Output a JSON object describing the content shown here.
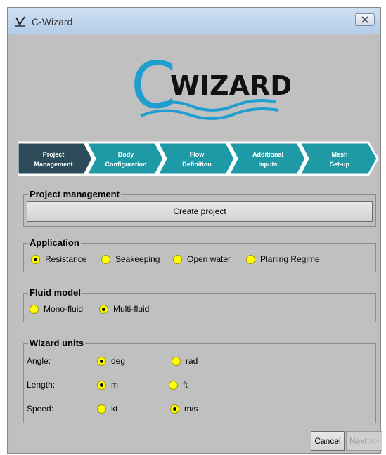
{
  "window": {
    "title": "C-Wizard",
    "close_icon": "close-icon"
  },
  "logo": {
    "text": "WIZARD",
    "letter": "C"
  },
  "steps": [
    {
      "line1": "Project",
      "line2": "Management",
      "active": true
    },
    {
      "line1": "Body",
      "line2": "Configuration",
      "active": false
    },
    {
      "line1": "Flow",
      "line2": "Definition",
      "active": false
    },
    {
      "line1": "Additional",
      "line2": "Inputs",
      "active": false
    },
    {
      "line1": "Mesh",
      "line2": "Set-up",
      "active": false
    }
  ],
  "project_management": {
    "title": "Project management",
    "create_label": "Create project"
  },
  "application": {
    "title": "Application",
    "options": [
      "Resistance",
      "Seakeeping",
      "Open water",
      "Planing Regime"
    ],
    "selected": "Resistance"
  },
  "fluid_model": {
    "title": "Fluid model",
    "options": [
      "Mono-fluid",
      "Multi-fluid"
    ],
    "selected": "Multi-fluid"
  },
  "wizard_units": {
    "title": "Wizard units",
    "rows": [
      {
        "label": "Angle:",
        "options": [
          "deg",
          "rad"
        ],
        "selected": "deg"
      },
      {
        "label": "Length:",
        "options": [
          "m",
          "ft"
        ],
        "selected": "m"
      },
      {
        "label": "Speed:",
        "options": [
          "kt",
          "m/s"
        ],
        "selected": "m/s"
      }
    ]
  },
  "footer": {
    "cancel_label": "Cancel",
    "next_label": "Next >>",
    "next_enabled": false
  },
  "colors": {
    "step_active": "#2d4c5a",
    "step_inactive": "#1d9aa6",
    "radio_fill": "#ffff00",
    "logo_wave": "#1f9fd0"
  }
}
